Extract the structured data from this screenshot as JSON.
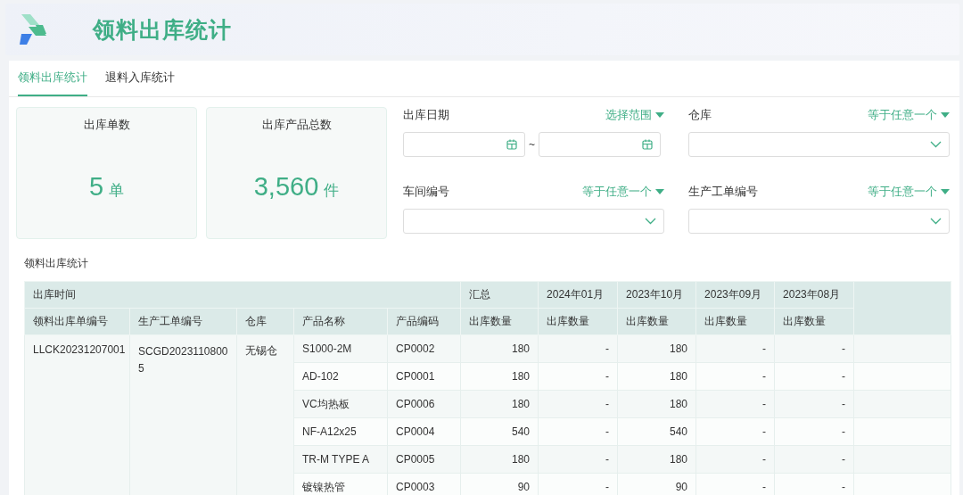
{
  "header": {
    "title": "领料出库统计"
  },
  "tabs": [
    {
      "label": "领料出库统计",
      "selected": true
    },
    {
      "label": "退料入库统计",
      "selected": false
    }
  ],
  "stats": [
    {
      "label": "出库单数",
      "value": "5",
      "unit": "单"
    },
    {
      "label": "出库产品总数",
      "value": "3,560",
      "unit": "件"
    }
  ],
  "filters": [
    {
      "kind": "date_range",
      "label": "出库日期",
      "operator": "选择范围",
      "separator": "~"
    },
    {
      "kind": "select",
      "label": "仓库",
      "operator": "等于任意一个"
    },
    {
      "kind": "select",
      "label": "车间编号",
      "operator": "等于任意一个"
    },
    {
      "kind": "select",
      "label": "生产工单编号",
      "operator": "等于任意一个"
    }
  ],
  "table": {
    "title": "领料出库统计",
    "group_header": "出库时间",
    "columns": [
      "领料出库单编号",
      "生产工单编号",
      "仓库",
      "产品名称",
      "产品编码"
    ],
    "value_columns": [
      {
        "group": "汇总",
        "label": "出库数量"
      },
      {
        "group": "2024年01月",
        "label": "出库数量"
      },
      {
        "group": "2023年10月",
        "label": "出库数量"
      },
      {
        "group": "2023年09月",
        "label": "出库数量"
      },
      {
        "group": "2023年08月",
        "label": "出库数量"
      }
    ],
    "order": {
      "order_no": "LLCK20231207001",
      "work_order": "SCGD20231108005",
      "warehouse": "无锡仓"
    },
    "rows": [
      {
        "name": "S1000-2M",
        "code": "CP0002",
        "values": [
          "180",
          "-",
          "180",
          "-",
          "-"
        ]
      },
      {
        "name": "AD-102",
        "code": "CP0001",
        "values": [
          "180",
          "-",
          "180",
          "-",
          "-"
        ]
      },
      {
        "name": "VC均热板",
        "code": "CP0006",
        "values": [
          "180",
          "-",
          "180",
          "-",
          "-"
        ]
      },
      {
        "name": "NF-A12x25",
        "code": "CP0004",
        "values": [
          "540",
          "-",
          "540",
          "-",
          "-"
        ]
      },
      {
        "name": "TR-M TYPE A",
        "code": "CP0005",
        "values": [
          "180",
          "-",
          "180",
          "-",
          "-"
        ]
      },
      {
        "name": "镀镍热管",
        "code": "CP0003",
        "values": [
          "90",
          "-",
          "90",
          "-",
          "-"
        ]
      }
    ]
  }
}
